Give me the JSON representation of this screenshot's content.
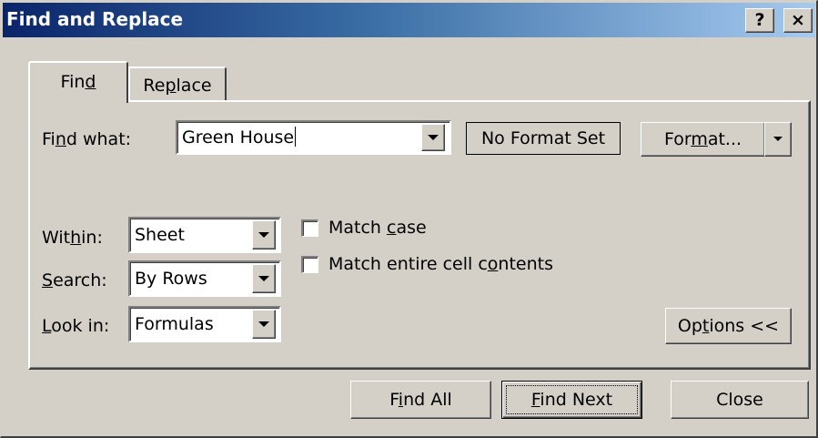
{
  "window": {
    "title": "Find and Replace",
    "help_label": "?",
    "close_label": "×"
  },
  "tabs": [
    {
      "label_pre": "Fin",
      "label_key": "d",
      "label_post": "",
      "active": true
    },
    {
      "label_pre": "Re",
      "label_key": "p",
      "label_post": "lace",
      "active": false
    }
  ],
  "find_what": {
    "label_pre": "Fi",
    "label_key": "n",
    "label_post": "d what:",
    "value": "Green House"
  },
  "format_preview": "No Format Set",
  "format_button": {
    "label_pre": "For",
    "label_key": "m",
    "label_post": "at..."
  },
  "within": {
    "label_pre": "Wit",
    "label_key": "h",
    "label_post": "in:",
    "value": "Sheet"
  },
  "search": {
    "label_pre": "",
    "label_key": "S",
    "label_post": "earch:",
    "value": "By Rows"
  },
  "look_in": {
    "label_pre": "",
    "label_key": "L",
    "label_post": "ook in:",
    "value": "Formulas"
  },
  "match_case": {
    "label_pre": "Match ",
    "label_key": "c",
    "label_post": "ase",
    "checked": false
  },
  "match_entire": {
    "label_pre": "Match entire cell c",
    "label_key": "o",
    "label_post": "ntents",
    "checked": false
  },
  "options_button": {
    "label_pre": "Op",
    "label_key": "t",
    "label_post": "ions <<"
  },
  "find_all_button": {
    "label_pre": "F",
    "label_key": "i",
    "label_post": "nd All"
  },
  "find_next_button": {
    "label_pre": "",
    "label_key": "F",
    "label_post": "ind Next"
  },
  "close_button": {
    "label": "Close"
  },
  "colors": {
    "titlebar_start": "#0a246a",
    "titlebar_end": "#a6caf0",
    "face": "#d4d0c8"
  }
}
